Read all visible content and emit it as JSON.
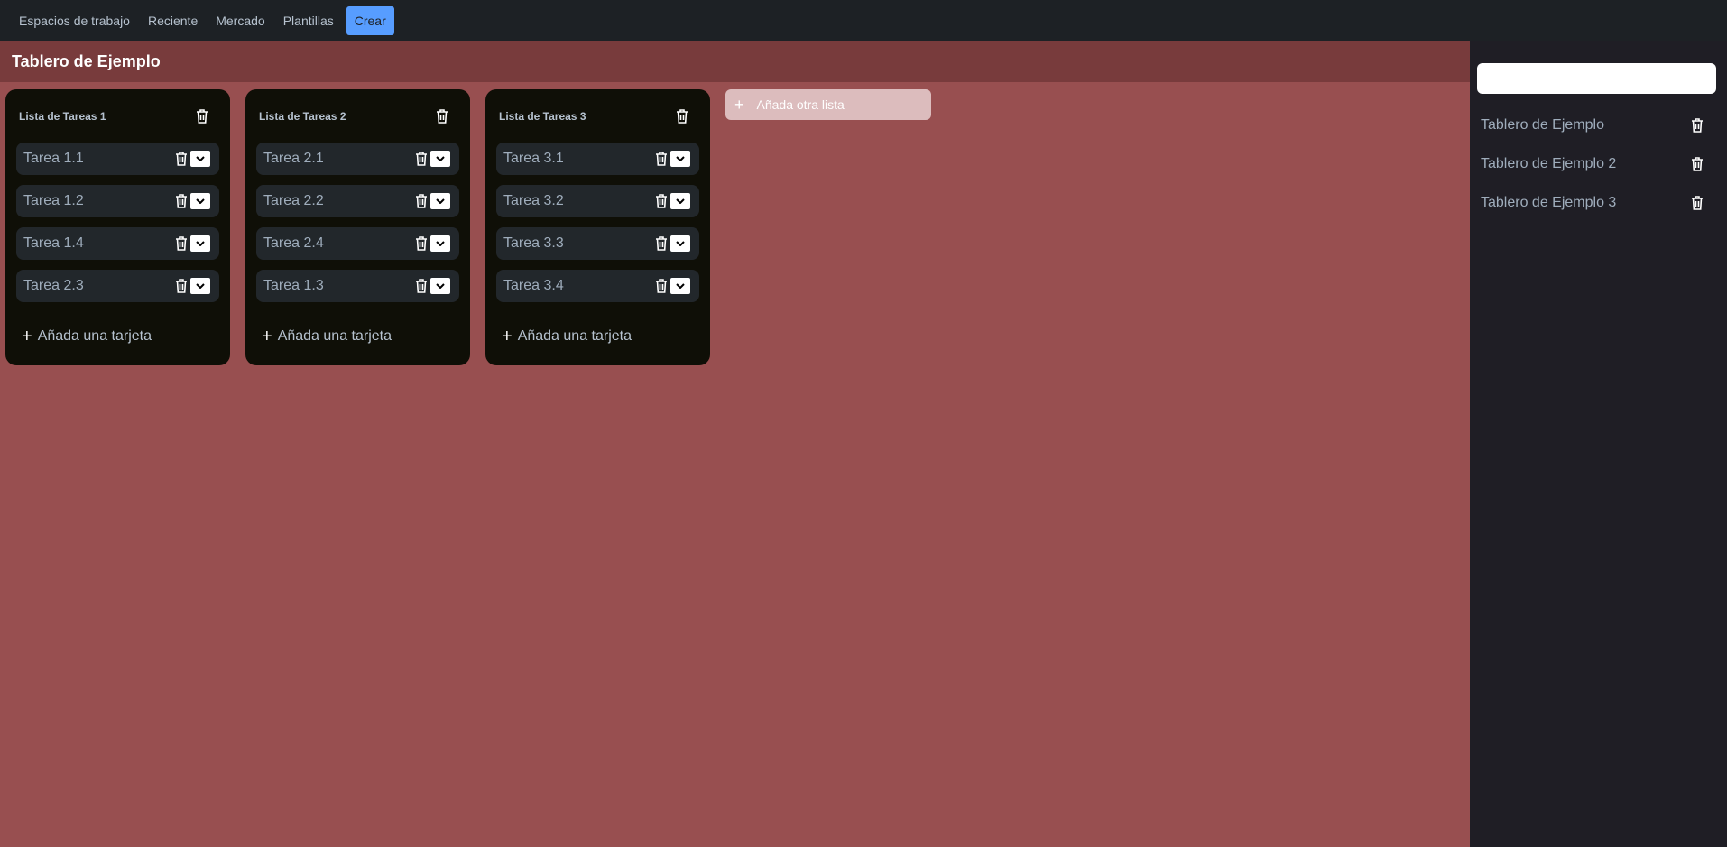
{
  "nav": {
    "items": [
      "Espacios de trabajo",
      "Reciente",
      "Mercado",
      "Plantillas"
    ],
    "create_label": "Crear"
  },
  "board": {
    "title": "Tablero de Ejemplo",
    "add_list_label": "Añada otra lista",
    "lists": [
      {
        "title": "Lista de Tareas 1",
        "cards": [
          "Tarea 1.1",
          "Tarea 1.2",
          "Tarea 1.4",
          "Tarea 2.3"
        ],
        "add_card_label": "Añada una tarjeta"
      },
      {
        "title": "Lista de Tareas 2",
        "cards": [
          "Tarea 2.1",
          "Tarea 2.2",
          "Tarea 2.4",
          "Tarea 1.3"
        ],
        "add_card_label": "Añada una tarjeta"
      },
      {
        "title": "Lista de Tareas 3",
        "cards": [
          "Tarea 3.1",
          "Tarea 3.2",
          "Tarea 3.3",
          "Tarea 3.4"
        ],
        "add_card_label": "Añada una tarjeta"
      }
    ]
  },
  "sidebar": {
    "search_value": "",
    "boards": [
      "Tablero de Ejemplo",
      "Tablero de Ejemplo 2",
      "Tablero de Ejemplo 3"
    ]
  },
  "colors": {
    "board_bg": "#984f50",
    "board_header_bg": "#783b3c",
    "list_bg": "#0f0f07",
    "card_bg": "#22272b",
    "create_accent": "#579dff"
  },
  "icons": {
    "trash": "trash-icon",
    "chevron": "chevron-down-icon",
    "plus": "plus-icon"
  }
}
